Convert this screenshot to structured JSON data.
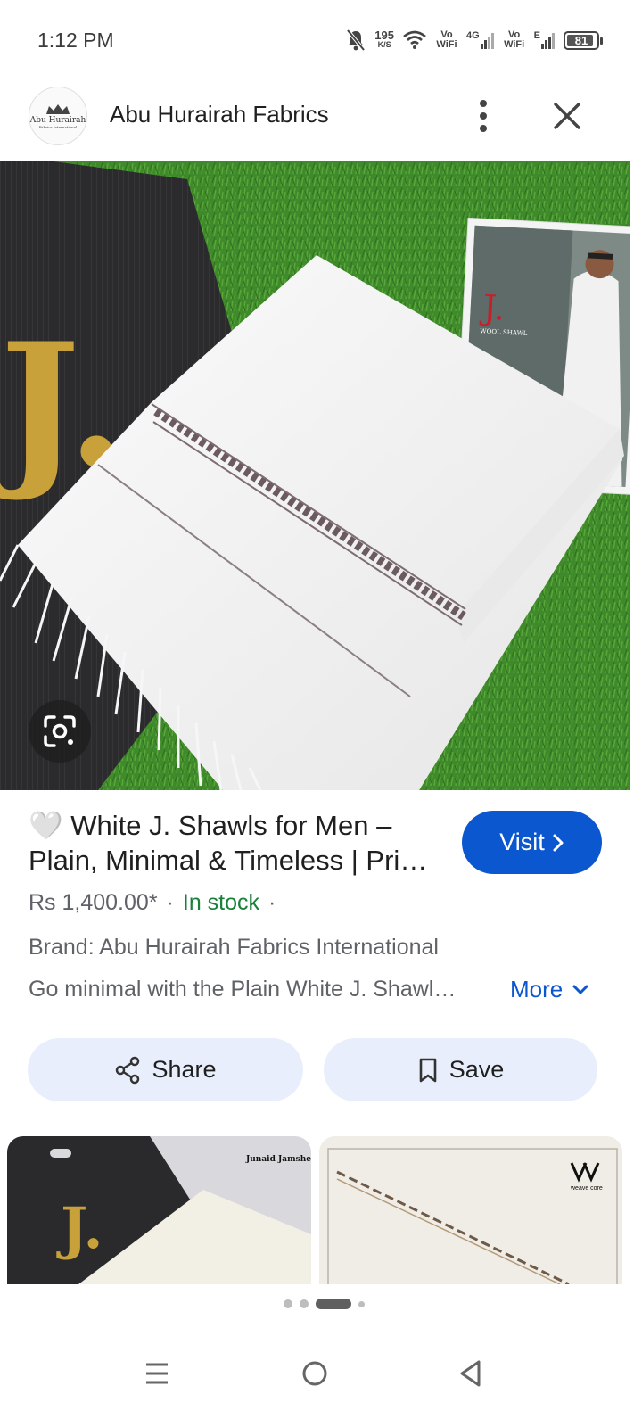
{
  "status_bar": {
    "time": "1:12 PM",
    "net_speed_value": "195",
    "net_speed_unit": "K/S",
    "volte1": "Vo WiFi",
    "network1": "4G",
    "volte2": "Vo WiFi",
    "network2": "E",
    "battery": "81"
  },
  "header": {
    "source_title": "Abu Hurairah Fabrics",
    "avatar_text_line1": "Abu Hurairah",
    "avatar_text_line2": "Fabrics International"
  },
  "hero": {
    "photo_card_text": "WOOL SHAWL",
    "brand_letter": "J."
  },
  "product": {
    "title_emoji": "🤍",
    "title": "White J. Shawls for Men – Plain, Minimal & Timeless | Pri…",
    "visit_label": "Visit",
    "price": "Rs 1,400.00*",
    "separator": "·",
    "stock": "In stock",
    "separator2": "·",
    "brand": "Brand: Abu Hurairah Fabrics International",
    "description": "Go minimal with the Plain White J. Shawl…",
    "more_label": "More"
  },
  "actions": {
    "share_label": "Share",
    "save_label": "Save"
  },
  "related": {
    "thumb1_brand": "Junaid Jamshed",
    "thumb1_letter": "J.",
    "thumb2_brand": "weave core"
  },
  "colors": {
    "accent": "#0b57d0",
    "stock_green": "#188038",
    "action_bg": "#e8eefb"
  }
}
